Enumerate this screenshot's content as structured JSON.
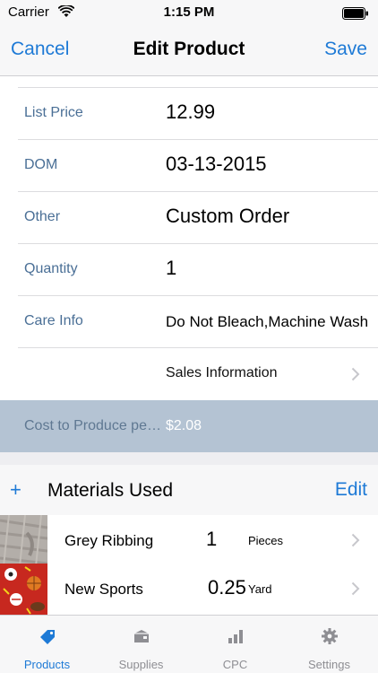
{
  "status_bar": {
    "carrier": "Carrier",
    "time": "1:15 PM"
  },
  "nav": {
    "cancel_label": "Cancel",
    "title": "Edit Product",
    "save_label": "Save"
  },
  "form": {
    "list_price": {
      "label": "List Price",
      "value": "12.99"
    },
    "dom": {
      "label": "DOM",
      "value": "03-13-2015"
    },
    "other": {
      "label": "Other",
      "value": "Custom Order"
    },
    "quantity": {
      "label": "Quantity",
      "value": "1"
    },
    "care_info": {
      "label": "Care Info",
      "value": "Do Not Bleach,Machine Wash"
    },
    "sales_information": {
      "label": "Sales Information"
    }
  },
  "cost": {
    "label": "Cost to Produce per Item",
    "value": "$2.08"
  },
  "materials": {
    "add_label": "+",
    "title": "Materials Used",
    "edit_label": "Edit",
    "items": [
      {
        "name": "Grey Ribbing",
        "quantity": "1",
        "unit": "Pieces"
      },
      {
        "name": "New Sports",
        "quantity": "0.25",
        "unit": "Yard"
      }
    ]
  },
  "tabs": [
    {
      "label": "Products",
      "icon": "tag-icon",
      "active": true
    },
    {
      "label": "Supplies",
      "icon": "box-icon",
      "active": false
    },
    {
      "label": "CPC",
      "icon": "bar-chart-icon",
      "active": false
    },
    {
      "label": "Settings",
      "icon": "gear-icon",
      "active": false
    }
  ],
  "colors": {
    "accent": "#1e7ad6",
    "label": "#4a6f96",
    "cost_background": "#b4c3d3"
  }
}
